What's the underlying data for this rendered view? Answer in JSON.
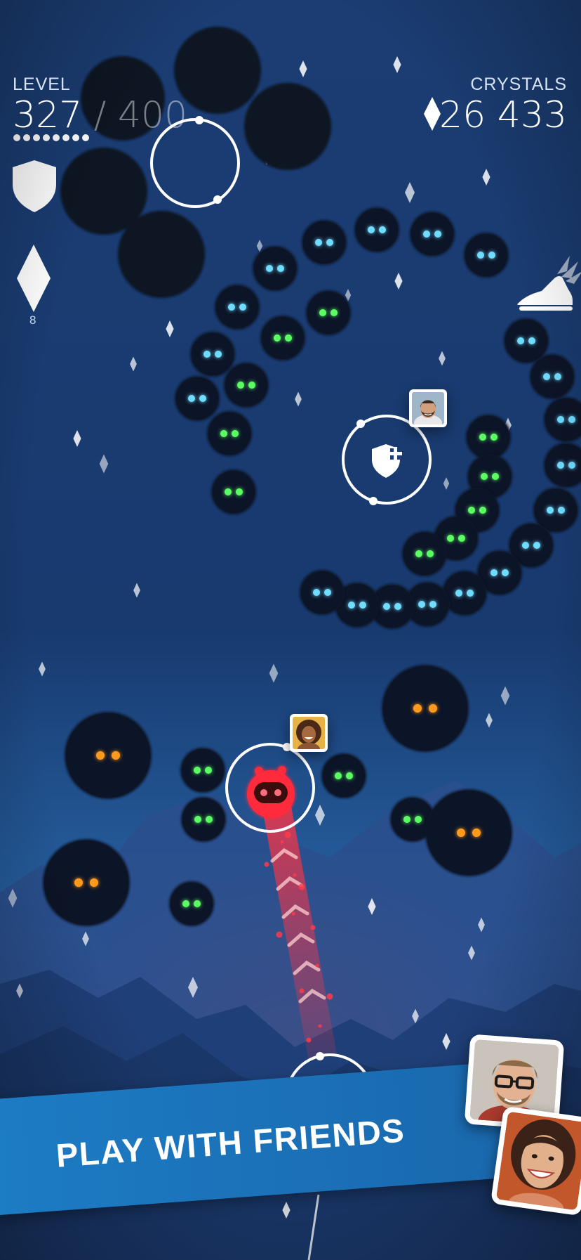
{
  "hud": {
    "level_label": "LEVEL",
    "level_current": "327",
    "level_total": " / 400",
    "crystals_label": "CRYSTALS",
    "crystals_value": "26 433",
    "crystal_powerup_count": "8",
    "progress_dots_filled": 8,
    "icons": [
      "shield-icon",
      "diamond-icon",
      "winged-shoe-icon",
      "shield-plus-icon"
    ]
  },
  "banner": {
    "text": "PLAY WITH FRIENDS"
  },
  "colors": {
    "sky_top": "#1b3d73",
    "sky_mid": "#17366a",
    "sky_bottom": "#2e78c0",
    "horizon_glow": "#d24a4a",
    "player": "#ff2a3a",
    "eyes_cyan": "#6fdcff",
    "eyes_green": "#5cff63",
    "eyes_orange": "#ff9a1c",
    "banner": "#1c7cc4"
  },
  "friends": [
    {
      "name": "friend-bearded-man"
    },
    {
      "name": "friend-curly-woman"
    },
    {
      "name": "friend-glasses-man"
    },
    {
      "name": "friend-smiling-woman"
    }
  ]
}
